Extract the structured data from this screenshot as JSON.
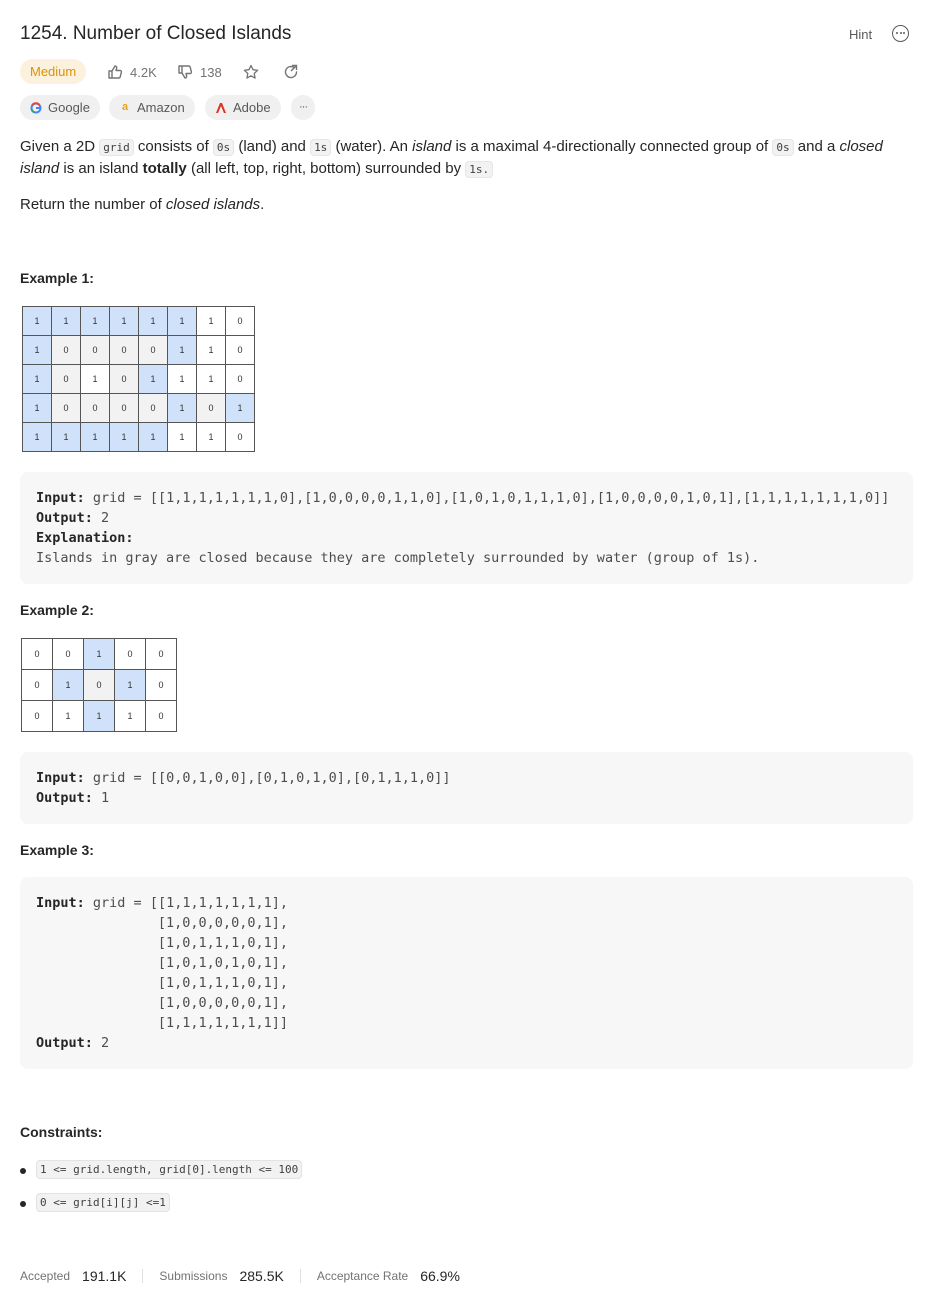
{
  "problem": {
    "title": "1254. Number of Closed Islands",
    "hint_label": "Hint",
    "difficulty": "Medium",
    "likes": "4.2K",
    "dislikes": "138",
    "companies": [
      "Google",
      "Amazon",
      "Adobe"
    ],
    "more_label": "···"
  },
  "description": {
    "p1_a": "Given a 2D ",
    "p1_code1": "grid",
    "p1_b": " consists of ",
    "p1_code2": "0s",
    "p1_c": " (land) and ",
    "p1_code3": "1s",
    "p1_d": " (water).  An ",
    "p1_em1": "island",
    "p1_e": " is a maximal 4-directionally connected group of ",
    "p1_code4": "0s",
    "p1_f": " and a ",
    "p1_em2": "closed island",
    "p1_g": " is an island ",
    "p1_strong": "totally",
    "p1_h": " (all left, top, right, bottom) surrounded by ",
    "p1_code5": "1s.",
    "p2_a": "Return the number of ",
    "p2_em": "closed islands",
    "p2_b": "."
  },
  "examples": [
    {
      "title": "Example 1:",
      "grid": [
        [
          1,
          1,
          1,
          1,
          1,
          1,
          1,
          0
        ],
        [
          1,
          0,
          0,
          0,
          0,
          1,
          1,
          0
        ],
        [
          1,
          0,
          1,
          0,
          1,
          1,
          1,
          0
        ],
        [
          1,
          0,
          0,
          0,
          0,
          1,
          0,
          1
        ],
        [
          1,
          1,
          1,
          1,
          1,
          1,
          1,
          0
        ]
      ],
      "input_label": "Input:",
      "input": "grid = [[1,1,1,1,1,1,1,0],[1,0,0,0,0,1,1,0],[1,0,1,0,1,1,1,0],[1,0,0,0,0,1,0,1],[1,1,1,1,1,1,1,0]]",
      "output_label": "Output:",
      "output": "2",
      "explanation_label": "Explanation:",
      "explanation": "Islands in gray are closed because they are completely surrounded by water (group of 1s)."
    },
    {
      "title": "Example 2:",
      "grid": [
        [
          0,
          0,
          1,
          0,
          0
        ],
        [
          0,
          1,
          0,
          1,
          0
        ],
        [
          0,
          1,
          1,
          1,
          0
        ]
      ],
      "input_label": "Input:",
      "input": "grid = [[0,0,1,0,0],[0,1,0,1,0],[0,1,1,1,0]]",
      "output_label": "Output:",
      "output": "1"
    },
    {
      "title": "Example 3:",
      "input_label": "Input:",
      "input_lines": [
        "grid = [[1,1,1,1,1,1,1],",
        "               [1,0,0,0,0,0,1],",
        "               [1,0,1,1,1,0,1],",
        "               [1,0,1,0,1,0,1],",
        "               [1,0,1,1,1,0,1],",
        "               [1,0,0,0,0,0,1],",
        "               [1,1,1,1,1,1,1]]"
      ],
      "output_label": "Output:",
      "output": "2"
    }
  ],
  "constraints": {
    "title": "Constraints:",
    "items": [
      "1 <= grid.length, grid[0].length <= 100",
      "0 <= grid[i][j] <=1"
    ]
  },
  "stats": {
    "accepted_label": "Accepted",
    "accepted": "191.1K",
    "submissions_label": "Submissions",
    "submissions": "285.5K",
    "rate_label": "Acceptance Rate",
    "rate": "66.9%"
  }
}
